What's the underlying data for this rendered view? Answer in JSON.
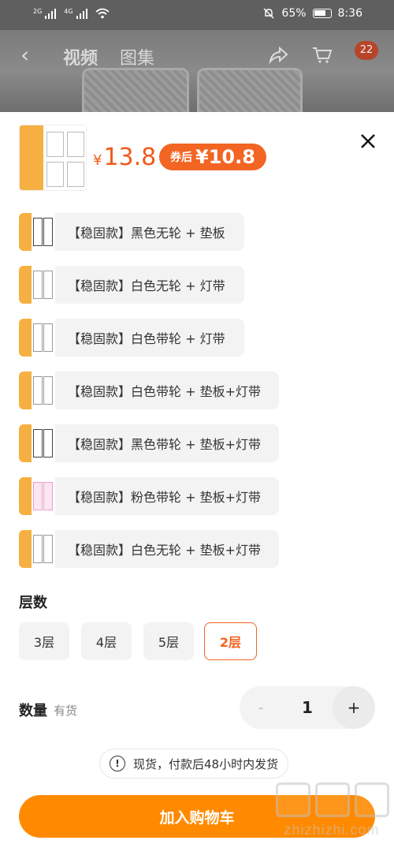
{
  "status_bar": {
    "signal1_tag": "2G",
    "signal2_tag": "4G",
    "battery": "65%",
    "time": "8:36"
  },
  "header": {
    "tab_video": "视频",
    "tab_gallery": "图集",
    "cart_count": "22"
  },
  "product": {
    "currency": "¥",
    "price": "13.8",
    "coupon_label": "券后",
    "coupon_price": "¥10.8"
  },
  "options": [
    {
      "label": "【稳固款】黑色无轮 + 垫板"
    },
    {
      "label": "【稳固款】白色无轮 + 灯带"
    },
    {
      "label": "【稳固款】白色带轮 + 灯带"
    },
    {
      "label": "【稳固款】白色带轮 + 垫板+灯带"
    },
    {
      "label": "【稳固款】黑色带轮 + 垫板+灯带"
    },
    {
      "label": "【稳固款】粉色带轮 + 垫板+灯带"
    },
    {
      "label": "【稳固款】白色无轮 + 垫板+灯带"
    }
  ],
  "layers": {
    "title": "层数",
    "options": [
      "3层",
      "4层",
      "5层",
      "2层"
    ],
    "selected": "2层"
  },
  "quantity": {
    "label": "数量",
    "stock": "有货",
    "minus": "-",
    "value": "1",
    "plus": "+"
  },
  "notice": {
    "icon": "!",
    "text": "现货，付款后48小时内发货"
  },
  "cart_button": "加入购物车",
  "watermark": "zhizhizhi.com",
  "colors": {
    "accent": "#f26522",
    "cart_button": "#ff8a00",
    "price": "#f05a1a"
  }
}
